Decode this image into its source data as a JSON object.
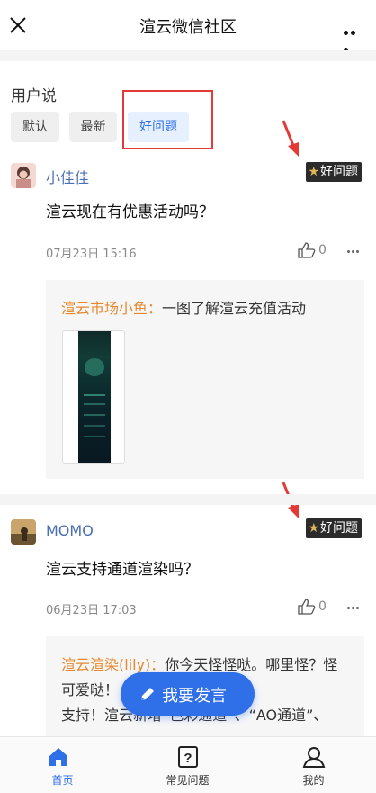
{
  "header": {
    "title": "渲云微信社区"
  },
  "section": {
    "title": "用户说"
  },
  "filters": [
    {
      "label": "默认",
      "active": false
    },
    {
      "label": "最新",
      "active": false
    },
    {
      "label": "好问题",
      "active": true
    }
  ],
  "posts": [
    {
      "username": "小佳佳",
      "badge": "好问题",
      "question": "渲云现在有优惠活动吗？",
      "time": "07月23日 15:16",
      "likes": "0",
      "reply": {
        "author": "渲云市场小鱼：",
        "text": "一图了解渲云充值活动"
      }
    },
    {
      "username": "MOMO",
      "badge": "好问题",
      "question": "渲云支持通道渲染吗？",
      "time": "06月23日 17:03",
      "likes": "0",
      "reply": {
        "author": "渲云渲染(lily)：",
        "text": "你今天怪怪哒。哪里怪？怪可爱哒！",
        "text2": "支持！渲云新增“色彩通道”、“AO通道”、"
      }
    }
  ],
  "fab": {
    "label": "我要发言"
  },
  "tabbar": [
    {
      "label": "首页",
      "active": true
    },
    {
      "label": "常见问题",
      "active": false
    },
    {
      "label": "我的",
      "active": false
    }
  ],
  "colors": {
    "accent": "#2f6fe8",
    "username": "#4a6fb5",
    "reply_author": "#e8882d",
    "badge_bg": "#2b2b2b",
    "badge_star": "#e0b45a",
    "highlight": "#e53935"
  },
  "icons": [
    "close-icon",
    "more-icon",
    "star-icon",
    "thumb-up-icon",
    "ellipsis-icon",
    "pen-icon",
    "home-icon",
    "help-icon",
    "user-icon",
    "arrow-icon"
  ]
}
